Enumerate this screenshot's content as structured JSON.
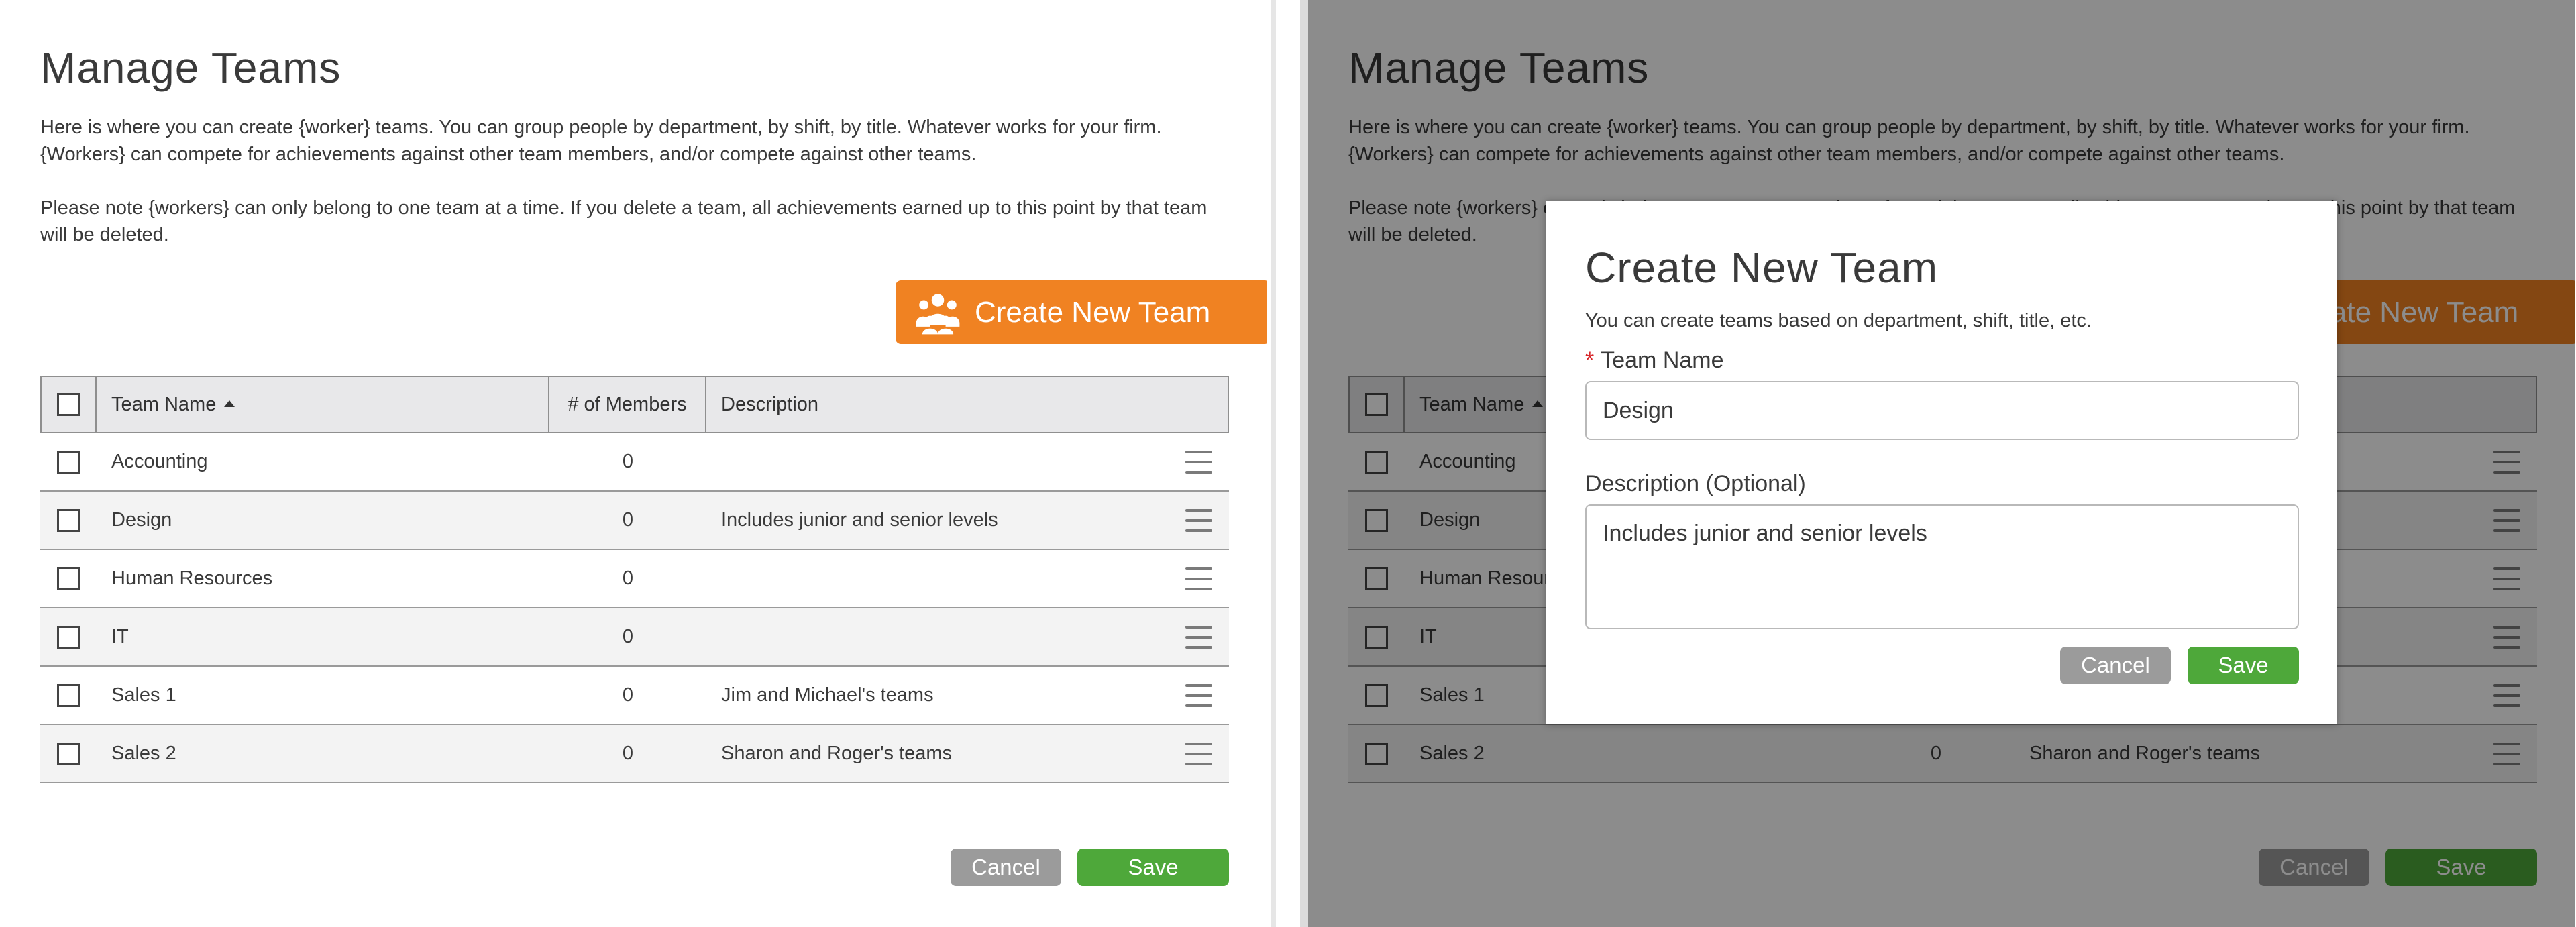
{
  "page": {
    "title": "Manage Teams",
    "intro": "Here is where you can create {worker} teams. You can group people by department, by shift, by title. Whatever works for your firm. {Workers} can compete for achievements against other team members, and/or compete against other teams.",
    "note": "Please note {workers} can only belong to one team at a time. If you delete a team, all achievements earned up to this point by that team will be deleted.",
    "create_button": "Create New Team",
    "cancel_label": "Cancel",
    "save_label": "Save"
  },
  "table": {
    "headers": {
      "name": "Team Name",
      "members": "# of Members",
      "description": "Description"
    },
    "rows": [
      {
        "name": "Accounting",
        "members": "0",
        "description": ""
      },
      {
        "name": "Design",
        "members": "0",
        "description": "Includes junior and senior levels"
      },
      {
        "name": "Human Resources",
        "members": "0",
        "description": ""
      },
      {
        "name": "IT",
        "members": "0",
        "description": ""
      },
      {
        "name": "Sales 1",
        "members": "0",
        "description": "Jim and Michael's teams"
      },
      {
        "name": "Sales 2",
        "members": "0",
        "description": "Sharon and Roger's teams"
      }
    ]
  },
  "modal": {
    "title": "Create New Team",
    "subtitle": "You can create teams based on department, shift, title, etc.",
    "required_mark": "*",
    "name_label": "Team Name",
    "name_value": "Design",
    "description_label": "Description (Optional)",
    "description_value": "Includes junior and senior levels",
    "cancel_label": "Cancel",
    "save_label": "Save"
  },
  "colors": {
    "accent_orange": "#f08222",
    "save_green": "#4ea83a",
    "cancel_gray": "#9b9b9b",
    "required_red": "#d8262a"
  },
  "icons": {
    "create_button_icon": "team-group-icon",
    "row_menu_icon": "hamburger-menu-icon",
    "sort_icon": "sort-ascending-icon"
  }
}
